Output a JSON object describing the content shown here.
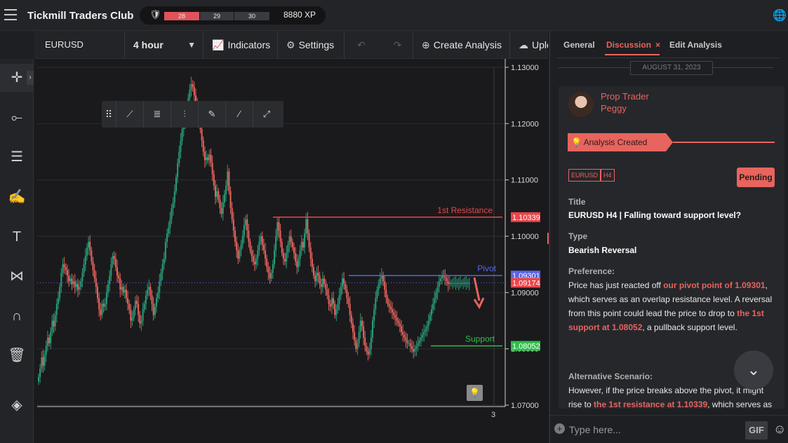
{
  "header": {
    "brand": "Tickmill Traders Club",
    "levels": [
      "28",
      "29",
      "30"
    ],
    "xp": "8880 XP",
    "icons": {
      "menu": "hamburger-icon",
      "badge": "badge-icon",
      "language": "globe-icon"
    }
  },
  "toolbar": {
    "symbol": "EURUSD",
    "timeframe": "4 hour",
    "indicators": "Indicators",
    "settings": "Settings",
    "create_analysis": "Create Analysis",
    "upload": "Upload"
  },
  "left_tools": [
    "crosshair-icon",
    "line-icon",
    "fib-icon",
    "brush-icon",
    "text-icon",
    "pattern-icon",
    "magnet-icon",
    "trash-icon",
    "layers-icon"
  ],
  "draw_tools": [
    "grip-icon",
    "trend-line-icon",
    "fib-retracement-icon",
    "channel-icon",
    "brush-icon",
    "ray-icon",
    "extended-line-icon"
  ],
  "chart": {
    "time_label": "3",
    "price_labels": [
      "1.13000",
      "1.12000",
      "1.11000",
      "1.10000",
      "1.09000",
      "1.08000",
      "1.07000"
    ],
    "levels": [
      {
        "name": "1st Resistance",
        "price": 1.10339,
        "label": "1.10339",
        "color": "#e8464b"
      },
      {
        "name": "Pivot",
        "price": 1.09301,
        "label": "1.09301",
        "color": "#5a64e6"
      },
      {
        "name": "Support",
        "price": 1.08052,
        "label": "1.08052",
        "color": "#2fbf4a"
      }
    ],
    "current_price": {
      "price": 1.09174,
      "label": "1.09174",
      "color": "#e8464b"
    },
    "up_color": "#2a9d78",
    "down_color": "#e8645e"
  },
  "chart_data": {
    "type": "candlestick",
    "symbol": "EURUSD",
    "timeframe": "4 hour",
    "ylim": [
      1.07,
      1.13
    ],
    "x": [
      1,
      2,
      3,
      4,
      5,
      6,
      7,
      8,
      9,
      10,
      11,
      12,
      13,
      14,
      15,
      16,
      17,
      18,
      19,
      20,
      21,
      22,
      23,
      24,
      25,
      26,
      27,
      28,
      29,
      30,
      31,
      32,
      33,
      34,
      35,
      36,
      37,
      38,
      39,
      40,
      41,
      42,
      43,
      44,
      45,
      46,
      47,
      48,
      49,
      50,
      51,
      52,
      53,
      54,
      55,
      56,
      57,
      58,
      59,
      60,
      61,
      62,
      63,
      64,
      65,
      66,
      67,
      68,
      69,
      70,
      71,
      72,
      73,
      74,
      75,
      76,
      77,
      78,
      79,
      80,
      81,
      82,
      83,
      84,
      85,
      86,
      87,
      88,
      89,
      90,
      91,
      92,
      93,
      94,
      95,
      96,
      97,
      98,
      99,
      100,
      101,
      102,
      103,
      104,
      105,
      106,
      107,
      108,
      109,
      110,
      111,
      112,
      113,
      114,
      115,
      116,
      117,
      118,
      119,
      120,
      121,
      122,
      123,
      124,
      125,
      126,
      127,
      128,
      129,
      130,
      131,
      132,
      133,
      134,
      135,
      136,
      137,
      138,
      139,
      140,
      141,
      142,
      143,
      144,
      145,
      146,
      147,
      148,
      149,
      150,
      151,
      152,
      153,
      154,
      155,
      156,
      157,
      158,
      159,
      160,
      161,
      162,
      163,
      164,
      165,
      166,
      167,
      168,
      169,
      170,
      171,
      172,
      173,
      174,
      175,
      176,
      177,
      178,
      179,
      180,
      181,
      182,
      183,
      184,
      185,
      186,
      187,
      188,
      189,
      190,
      191,
      192,
      193,
      194,
      195,
      196,
      197,
      198,
      199,
      200,
      201,
      202,
      203,
      204,
      205,
      206,
      207,
      208,
      209,
      210,
      211,
      212,
      213,
      214,
      215,
      216,
      217,
      218,
      219,
      220,
      221,
      222,
      223,
      224,
      225,
      226,
      227,
      228,
      229,
      230,
      231,
      232,
      233,
      234,
      235,
      236,
      237,
      238,
      239,
      240,
      241,
      242,
      243,
      244,
      245,
      246,
      247,
      248,
      249,
      250,
      251,
      252,
      253,
      254,
      255,
      256,
      257,
      258,
      259,
      260,
      261,
      262,
      263,
      264,
      265,
      266,
      267,
      268,
      269,
      270,
      271,
      272,
      273,
      274,
      275,
      276,
      277,
      278,
      279,
      280,
      281,
      282,
      283,
      284,
      285,
      286,
      287,
      288,
      289,
      290,
      291,
      292,
      293,
      294,
      295,
      296,
      297,
      298,
      299,
      300,
      301,
      302,
      303,
      304,
      305,
      306,
      307,
      308,
      309,
      310
    ],
    "close": [
      1.075,
      1.0765,
      1.0785,
      1.077,
      1.079,
      1.0805,
      1.082,
      1.081,
      1.083,
      1.085,
      1.084,
      1.086,
      1.088,
      1.089,
      1.091,
      1.0935,
      1.095,
      1.0945,
      1.094,
      1.093,
      1.092,
      1.0925,
      1.0915,
      1.092,
      1.091,
      1.0915,
      1.0905,
      1.091,
      1.092,
      1.0935,
      1.095,
      1.0965,
      1.098,
      1.099,
      1.0975,
      1.0955,
      1.094,
      1.0925,
      1.091,
      1.089,
      1.087,
      1.086,
      1.088,
      1.0875,
      1.088,
      1.09,
      1.0915,
      1.093,
      1.095,
      1.0965,
      1.096,
      1.0945,
      1.093,
      1.0925,
      1.0905,
      1.091,
      1.09,
      1.0905,
      1.089,
      1.088,
      1.087,
      1.085,
      1.0855,
      1.087,
      1.0885,
      1.088,
      1.086,
      1.0845,
      1.085,
      1.087,
      1.088,
      1.0895,
      1.0905,
      1.091,
      1.0895,
      1.088,
      1.086,
      1.0875,
      1.089,
      1.09,
      1.092,
      1.0935,
      1.095,
      1.096,
      1.099,
      1.1005,
      1.1015,
      1.103,
      1.105,
      1.106,
      1.108,
      1.1105,
      1.113,
      1.115,
      1.117,
      1.119,
      1.12,
      1.121,
      1.1225,
      1.1245,
      1.126,
      1.127,
      1.1265,
      1.125,
      1.124,
      1.123,
      1.121,
      1.119,
      1.117,
      1.115,
      1.1135,
      1.114,
      1.1135,
      1.1145,
      1.113,
      1.111,
      1.109,
      1.107,
      1.108,
      1.1065,
      1.105,
      1.104,
      1.106,
      1.1075,
      1.109,
      1.1115,
      1.108,
      1.105,
      1.103,
      1.101,
      1.099,
      1.0975,
      1.096,
      1.0975,
      1.0985,
      1.1,
      1.102,
      1.103,
      1.101,
      1.099,
      1.0975,
      1.0965,
      1.0955,
      1.095,
      1.096,
      1.0975,
      1.099,
      1.1,
      1.0985,
      1.0975,
      1.096,
      1.0945,
      1.0935,
      1.0925,
      1.0935,
      1.095,
      1.0975,
      1.1,
      1.1025,
      1.101,
      1.099,
      1.097,
      1.096,
      1.0955,
      1.097,
      1.0985,
      1.1,
      1.099,
      1.098,
      1.097,
      1.0955,
      1.0945,
      1.096,
      1.0975,
      1.099,
      1.098,
      1.1005,
      1.103,
      1.1005,
      1.098,
      1.096,
      1.0945,
      1.093,
      1.092,
      1.0935,
      1.093,
      1.0915,
      1.091,
      1.0925,
      1.0915,
      1.0905,
      1.0895,
      1.088,
      1.0875,
      1.089,
      1.088,
      1.086,
      1.087,
      1.088,
      1.0895,
      1.091,
      1.0925,
      1.0915,
      1.0905,
      1.089,
      1.088,
      1.086,
      1.0845,
      1.083,
      1.0815,
      1.08,
      1.081,
      1.083,
      1.085,
      1.084,
      1.082,
      1.0805,
      1.0795,
      1.079,
      1.08,
      1.082,
      1.085,
      1.087,
      1.089,
      1.0905,
      1.0915,
      1.0925,
      1.093,
      1.092,
      1.0905,
      1.089,
      1.088,
      1.0875,
      1.087,
      1.0865,
      1.086,
      1.0855,
      1.085,
      1.0845,
      1.084,
      1.083,
      1.0825,
      1.082,
      1.0815,
      1.081,
      1.081,
      1.0805,
      1.08,
      1.0795,
      1.08,
      1.0805,
      1.081,
      1.0815,
      1.082,
      1.0825,
      1.083,
      1.0835,
      1.084,
      1.085,
      1.086,
      1.087,
      1.088,
      1.089,
      1.09,
      1.091,
      1.092,
      1.0925,
      1.093,
      1.0928,
      1.0925,
      1.092,
      1.0915,
      1.0917,
      1.0917,
      1.0917,
      1.0917,
      1.0917,
      1.0917,
      1.0917,
      1.0917,
      1.0917,
      1.0917,
      1.0917,
      1.0917,
      1.0917,
      1.0917,
      1.0917,
      1.0917,
      1.0917,
      1.0917,
      1.0917,
      1.0917,
      1.0917,
      1.0917,
      1.0917,
      1.0917,
      1.0917,
      1.0917,
      1.0917,
      1.0917,
      1.0917,
      1.0917,
      1.0917,
      1.0917,
      1.0917,
      1.0917,
      1.0917,
      1.0917,
      1.0917,
      1.0917,
      1.0917,
      1.0917,
      1.0917,
      1.0917,
      1.0917,
      1.0917,
      1.0917,
      1.0917,
      1.0917,
      1.0917,
      1.0917,
      1.0917,
      1.0917
    ]
  },
  "panel": {
    "tabs": [
      "General",
      "Discussion",
      "Edit Analysis"
    ],
    "date": "AUGUST 31, 2023",
    "author_role": "Prop Trader",
    "author_name": "Peggy",
    "ribbon": "Analysis Created",
    "tags": [
      "EURUSD",
      "H4"
    ],
    "status": "Pending",
    "title_label": "Title",
    "title_value": "EURUSD H4 | Falling toward support level?",
    "type_label": "Type",
    "type_value": "Bearish Reversal",
    "preference_label": "Preference:",
    "pref_1": "Price has just reacted off ",
    "pref_hl1": "our pivot point of 1.09301",
    "pref_2": ", which serves as an overlap resistance level. A reversal from this point could lead the price to drop to ",
    "pref_hl2": "the 1st support at 1.08052",
    "pref_3": ", a pullback support level.",
    "alt_label": "Alternative Scenario:",
    "alt_1": " However, if the price breaks above the pivot, it might rise to ",
    "alt_hl": "the 1st resistance at 1.10339",
    "alt_2": ",  which serves as",
    "input_placeholder": "Type here...",
    "gif": "GIF"
  }
}
